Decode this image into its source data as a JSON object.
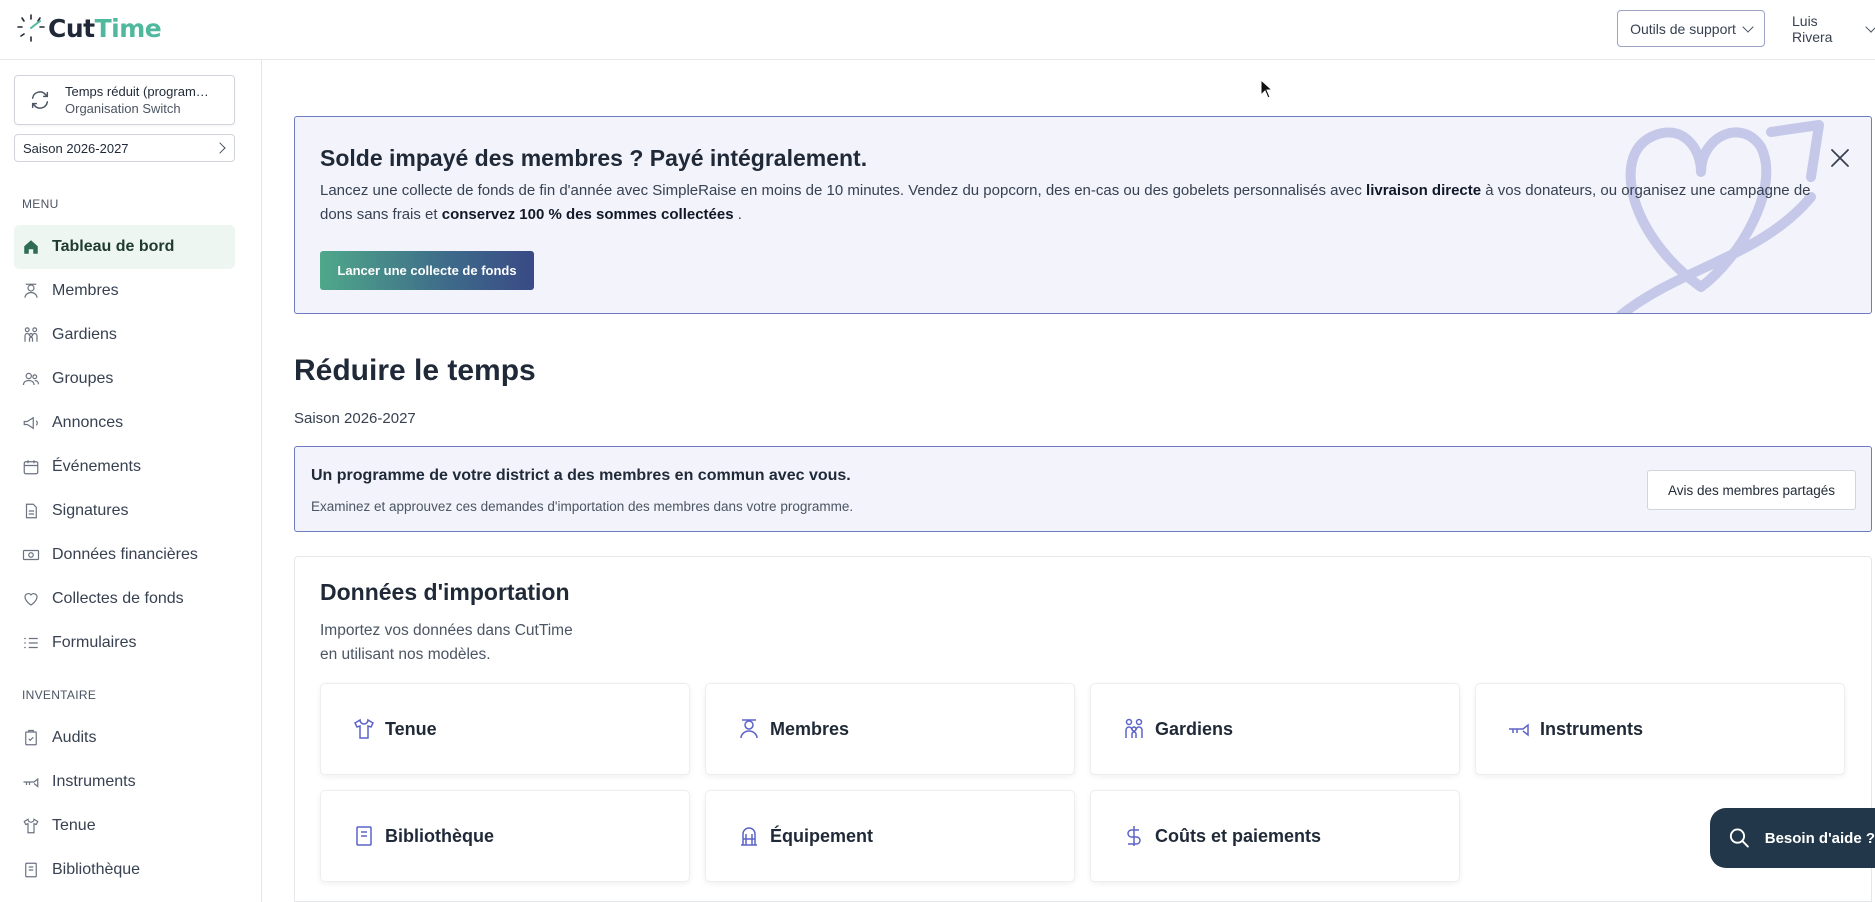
{
  "app": {
    "logo_cut": "Cut",
    "logo_time": "Time",
    "brand_color": "#4fb89e"
  },
  "header": {
    "support_label": "Outils de support",
    "user_name": "Luis Rivera"
  },
  "sidebar": {
    "org_name": "Temps réduit (program…",
    "org_subtitle": "Organisation Switch",
    "season": "Saison 2026-2027",
    "menu_label": "MENU",
    "items": [
      {
        "label": "Tableau de bord",
        "icon": "home-icon",
        "active": true
      },
      {
        "label": "Membres",
        "icon": "members-icon"
      },
      {
        "label": "Gardiens",
        "icon": "guardians-icon"
      },
      {
        "label": "Groupes",
        "icon": "groups-icon"
      },
      {
        "label": "Annonces",
        "icon": "megaphone-icon"
      },
      {
        "label": "Événements",
        "icon": "calendar-icon"
      },
      {
        "label": "Signatures",
        "icon": "document-icon"
      },
      {
        "label": "Données financières",
        "icon": "money-icon"
      },
      {
        "label": "Collectes de fonds",
        "icon": "heart-icon"
      },
      {
        "label": "Formulaires",
        "icon": "list-icon"
      }
    ],
    "inventory_label": "INVENTAIRE",
    "inventory_items": [
      {
        "label": "Audits",
        "icon": "clipboard-check-icon"
      },
      {
        "label": "Instruments",
        "icon": "trumpet-icon"
      },
      {
        "label": "Tenue",
        "icon": "shirt-icon"
      },
      {
        "label": "Bibliothèque",
        "icon": "book-icon"
      }
    ]
  },
  "banner": {
    "title": "Solde impayé des membres ? Payé intégralement.",
    "text_1": "Lancez une collecte de fonds de fin d'année avec SimpleRaise en moins de 10 minutes. Vendez du popcorn, des en-cas ou des gobelets personnalisés avec ",
    "bold_1": "livraison directe",
    "text_2": " à vos donateurs, ou organisez une campagne de dons sans frais et ",
    "bold_2": "conservez 100 % des sommes collectées",
    "text_3": " .",
    "cta": "Lancer une collecte de fonds"
  },
  "main": {
    "title": "Réduire le temps",
    "season": "Saison 2026-2027"
  },
  "shared": {
    "title": "Un programme de votre district a des membres en commun avec vous.",
    "description": "Examinez et approuvez ces demandes d'importation des membres dans votre programme.",
    "button": "Avis des membres partagés"
  },
  "import": {
    "title": "Données d'importation",
    "description": "Importez vos données dans CutTime en utilisant nos modèles.",
    "tiles": [
      {
        "label": "Tenue",
        "icon": "shirt-icon"
      },
      {
        "label": "Membres",
        "icon": "members-icon"
      },
      {
        "label": "Gardiens",
        "icon": "guardians-icon"
      },
      {
        "label": "Instruments",
        "icon": "trumpet-icon"
      },
      {
        "label": "Bibliothèque",
        "icon": "book-icon"
      },
      {
        "label": "Équipement",
        "icon": "equipment-icon"
      },
      {
        "label": "Coûts et paiements",
        "icon": "dollar-icon"
      }
    ]
  },
  "help": {
    "label": "Besoin d'aide ?"
  }
}
